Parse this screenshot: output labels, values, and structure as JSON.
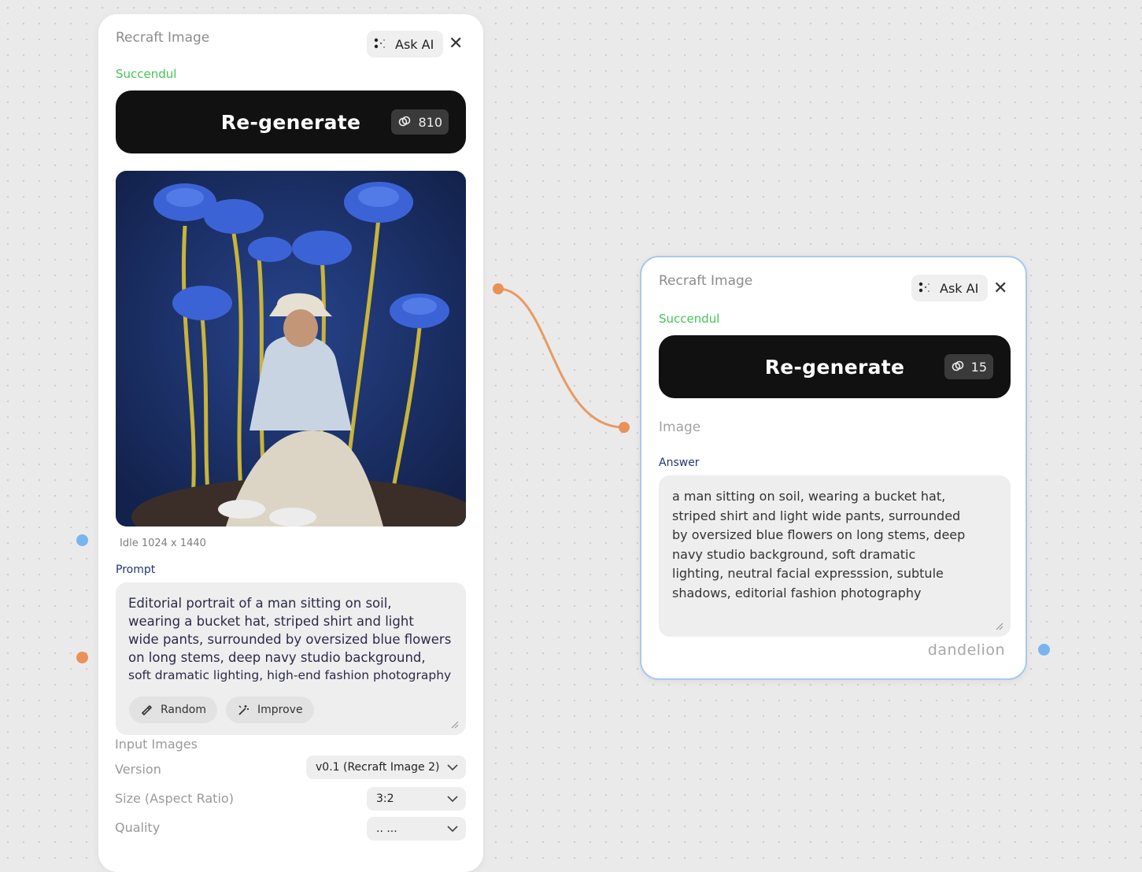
{
  "colors": {
    "success": "#42c556",
    "button_bg": "#111111",
    "port_blue": "#7ab4ee",
    "port_orange": "#e8925a",
    "connector": "#e89a64"
  },
  "left_node": {
    "title": "Recraft Image",
    "ask_ai_label": "Ask AI",
    "status": "Succendul",
    "regenerate_label": "Re-generate",
    "credits": "810",
    "image_meta": "Idle 1024 x 1440",
    "prompt_label": "Prompt",
    "prompt_lines": [
      "Editorial portrait of a man sitting on soil,",
      "wearing a bucket hat, striped shirt and light",
      "wide pants, surrounded by oversized blue flowers",
      "on long stems, deep navy studio background,",
      "soft dramatic lighting, high-end fashion photography"
    ],
    "random_label": "Random",
    "improve_label": "Improve",
    "input_images_label": "Input Images",
    "version_label": "Version",
    "version_value": "v0.1 (Recraft Image 2)",
    "size_label": "Size (Aspect Ratio)",
    "size_value": "3:2",
    "quality_label": "Quality",
    "quality_value": ".. ..."
  },
  "right_node": {
    "title": "Recraft Image",
    "ask_ai_label": "Ask AI",
    "status": "Succendul",
    "regenerate_label": "Re-generate",
    "credits": "15",
    "image_label": "Image",
    "answer_label": "Answer",
    "answer_lines": [
      "a man sitting on soil, wearing a bucket hat,",
      "striped shirt and light wide pants, surrounded",
      "by oversized blue flowers on long stems, deep",
      "navy studio background, soft dramatic",
      "lighting, neutral facial expresssion, subtule",
      "shadows, editorial fashion photography"
    ],
    "footer_brand": "dandelion"
  }
}
